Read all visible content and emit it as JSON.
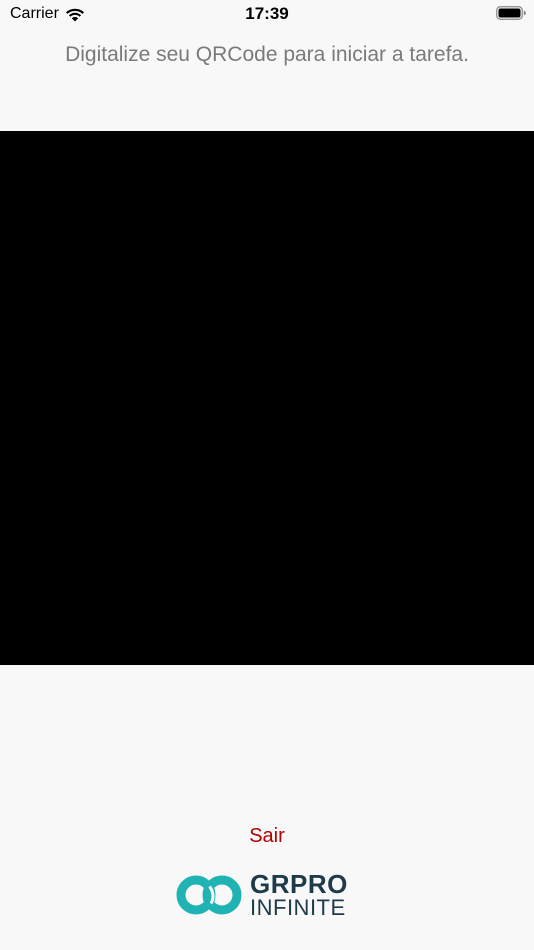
{
  "status_bar": {
    "carrier": "Carrier",
    "time": "17:39"
  },
  "instruction": "Digitalize seu QRCode para iniciar a tarefa.",
  "exit_label": "Sair",
  "logo": {
    "line1": "GRPRO",
    "line2": "INFINITE",
    "colors": {
      "mark": "#1fb3b3",
      "text": "#1d3b4a"
    }
  },
  "icons": {
    "wifi": "wifi-icon",
    "battery": "battery-icon"
  },
  "colors": {
    "background": "#f8f8f8",
    "camera": "#000000",
    "exit": "#b30000",
    "instruction": "#7a7a7a"
  }
}
